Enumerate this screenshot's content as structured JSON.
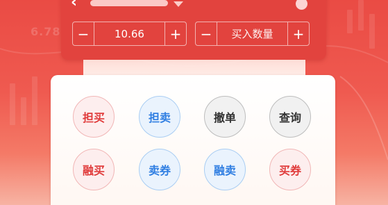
{
  "header": {
    "back_icon": "chevron-left-icon",
    "menu_icon": "triangle-down-icon"
  },
  "price_stepper": {
    "minus": "−",
    "value": "10.66",
    "plus": "+"
  },
  "quantity_stepper": {
    "minus": "−",
    "placeholder": "买入数量",
    "plus": "+"
  },
  "background_text": "6.78",
  "actions": [
    {
      "label": "担买",
      "style": "red"
    },
    {
      "label": "担卖",
      "style": "blue"
    },
    {
      "label": "撤单",
      "style": "gray"
    },
    {
      "label": "查询",
      "style": "gray"
    },
    {
      "label": "融买",
      "style": "red"
    },
    {
      "label": "卖券",
      "style": "blue"
    },
    {
      "label": "融卖",
      "style": "blue"
    },
    {
      "label": "买券",
      "style": "red"
    }
  ],
  "colors": {
    "background": "#ea4b44",
    "panel": "#e2433e",
    "buy_red": "#e03a3a",
    "sell_blue": "#2f7ee2",
    "neutral": "#333333"
  }
}
